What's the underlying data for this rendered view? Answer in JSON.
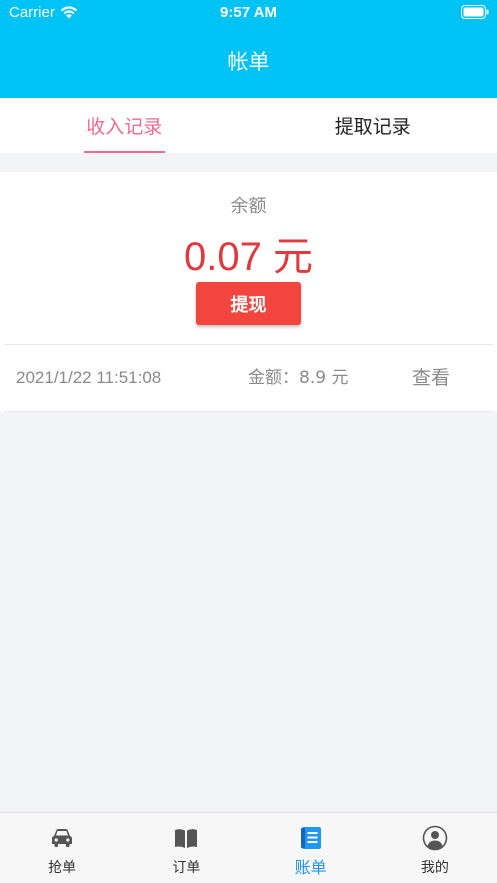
{
  "status_bar": {
    "carrier": "Carrier",
    "time": "9:57 AM"
  },
  "header": {
    "title": "帐单"
  },
  "tabs": [
    {
      "label": "收入记录",
      "active": true
    },
    {
      "label": "提取记录",
      "active": false
    }
  ],
  "balance": {
    "label": "余额",
    "amount": "0.07 元",
    "withdraw_label": "提现"
  },
  "records": [
    {
      "datetime": "2021/1/22 11:51:08",
      "amount": "金额：8.9 元",
      "action": "查看"
    }
  ],
  "tabbar": {
    "items": [
      {
        "label": "抢单",
        "icon": "car-icon",
        "active": false
      },
      {
        "label": "订单",
        "icon": "book-icon",
        "active": false
      },
      {
        "label": "账单",
        "icon": "bill-icon",
        "active": true
      },
      {
        "label": "我的",
        "icon": "user-icon",
        "active": false
      }
    ]
  },
  "colors": {
    "header": "#00c3f5",
    "tab_active": "#ef6b8f",
    "amount": "#e0393e",
    "withdraw_button": "#f1453d",
    "tabbar_active": "#2196f3"
  }
}
